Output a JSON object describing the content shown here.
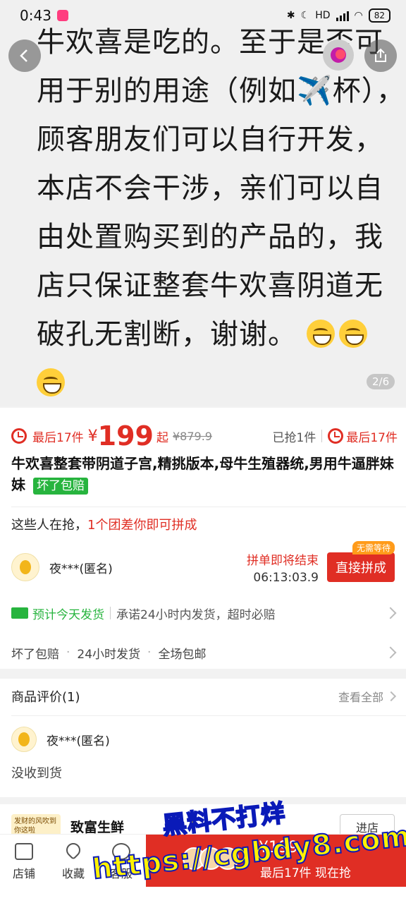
{
  "status_bar": {
    "time": "0:43",
    "battery": "82",
    "network": "HD"
  },
  "hero": {
    "lines": [
      "牛欢喜是吃的。至于是否可",
      "用于别的用途（例如✈️杯），",
      "顾客朋友们可以自行开发，",
      "本店不会干涉，亲们可以自",
      "由处置购买到的产品的，我",
      "店只保证整套牛欢喜阴道无",
      "破孔无割断，谢谢。"
    ],
    "page_counter": "2/6",
    "icons": [
      "back-arrow-icon",
      "share-icon",
      "tag-icon",
      "grinning-emoji"
    ]
  },
  "price": {
    "last_left": "最后17件",
    "currency": "¥",
    "value": "199",
    "suffix": "起",
    "original": "¥879.9",
    "sold": "已抢1件",
    "last_right": "最后17件"
  },
  "product": {
    "title": "牛欢喜整套带阴道子宫,精挑版本,母牛生殖器统,男用牛逼胖妹妹",
    "badge": "坏了包赔"
  },
  "group": {
    "heading_prefix": "这些人在抢，",
    "heading_highlight": "1个团差你即可拼成",
    "user": "夜***(匿名)",
    "ending_label": "拼单即将结束",
    "countdown": "06:13:03.9",
    "join_tag": "无需等待",
    "join_label": "直接拼成"
  },
  "shipping": {
    "label": "预计今天发货",
    "promise": "承诺24小时内发货，超时必赔"
  },
  "services": [
    "坏了包赔",
    "24小时发货",
    "全场包邮"
  ],
  "reviews": {
    "heading": "商品评价(1)",
    "see_all": "查看全部",
    "user": "夜***(匿名)",
    "text": "没收到货"
  },
  "store": {
    "logo_text": "发财的风吹到你这啦",
    "name": "致富生鲜",
    "enter": "进店"
  },
  "bottom_nav": {
    "shop": "店铺",
    "fav": "收藏",
    "service": "客服"
  },
  "buy": {
    "price": "¥199",
    "text": "最后17件 现在抢"
  },
  "watermark": {
    "line1": "黑料不打烊",
    "line2": "https://cgbdy8.com"
  },
  "colors": {
    "accent_red": "#e02e24",
    "green": "#27b43e",
    "watermark_fill": "#fff200",
    "watermark_stroke": "#0a1ab8"
  }
}
